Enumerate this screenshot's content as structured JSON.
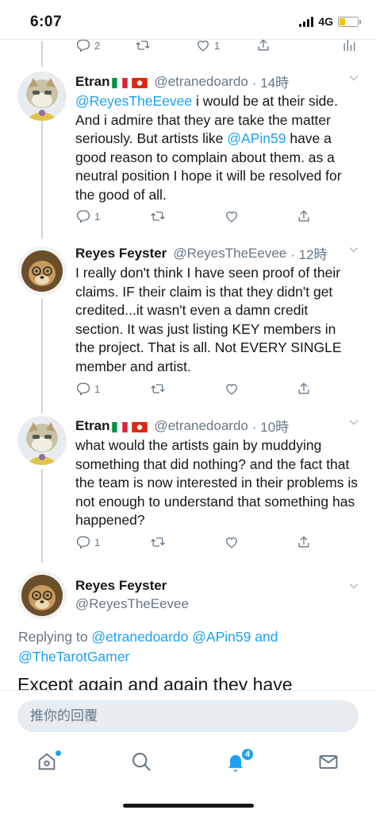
{
  "status_bar": {
    "time": "6:07",
    "network": "4G"
  },
  "top_actions": {
    "reply_count": "2",
    "like_count": "1"
  },
  "tweets": [
    {
      "name": "Etran",
      "handle": "@etranedoardo",
      "time": "· 14時",
      "text_mention": "@ReyesTheEevee",
      "text_part1": " i would be at their side. And i admire that they are take the matter seriously.  But artists like ",
      "text_mention2": "@APin59",
      "text_part2": "  have a good reason to complain about them.  as a neutral position I hope it will be resolved for the good of all.",
      "reply_count": "1"
    },
    {
      "name": "Reyes Feyster",
      "handle": "@ReyesTheEevee",
      "time": "· 12時",
      "text": "I really don't think I have seen proof of their claims. IF their claim is that they didn't get credited...it wasn't even a damn credit section. It was just listing KEY members in the project. That is all. Not EVERY SINGLE member and artist.",
      "reply_count": "1"
    },
    {
      "name": "Etran",
      "handle": "@etranedoardo",
      "time": "· 10時",
      "text": "what would the artists gain by muddying something that did nothing?  and the fact that the team is now interested in their problems is not enough to understand that something has happened?",
      "reply_count": "1"
    }
  ],
  "focus_tweet": {
    "name": "Reyes Feyster",
    "handle": "@ReyesTheEevee",
    "replying_label": "Replying to ",
    "replying_mention1": "@etranedoardo",
    "replying_mention2": "@APin59",
    "replying_and": " and",
    "replying_mention3": "@TheTarotGamer",
    "text": "Except again and again they have"
  },
  "reply_box": {
    "placeholder": "推你的回覆"
  },
  "tab_bar": {
    "notification_count": "4"
  },
  "colors": {
    "accent": "#1da1f2",
    "muted": "#657786",
    "divider": "#e6ecf0",
    "battery": "#f5c400"
  },
  "icons": [
    "reply-icon",
    "retweet-icon",
    "like-icon",
    "share-icon",
    "analytics-icon",
    "chevron-down-icon",
    "home-icon",
    "search-icon",
    "notifications-icon",
    "messages-icon"
  ]
}
